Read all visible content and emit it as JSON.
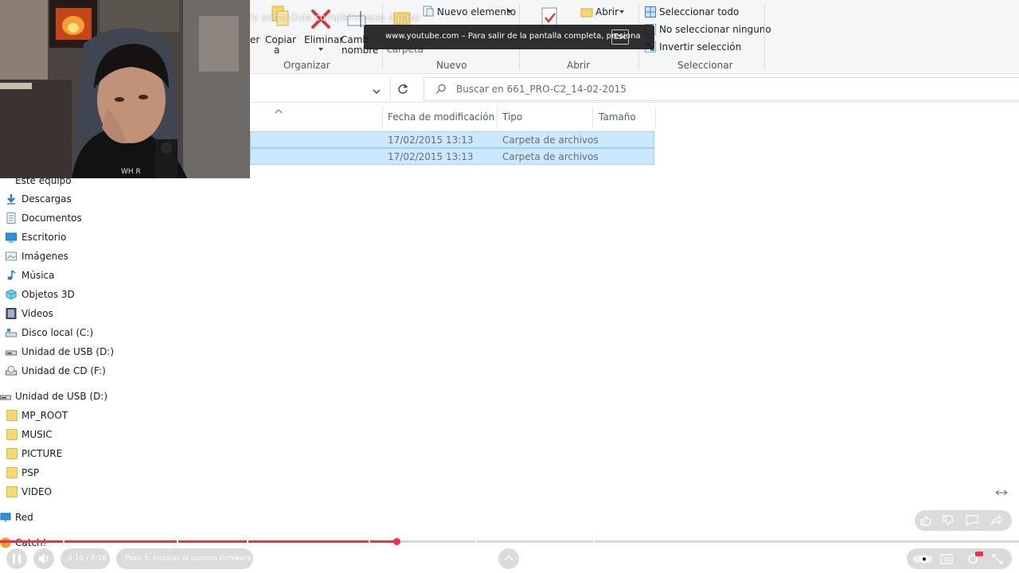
{
  "video_overlay": {
    "title_faint": "ly porta Guia completa paso a paso",
    "fullscreen_msg": "www.youtube.com – Para salir de la pantalla completa, presiona",
    "esc_key": "Esc"
  },
  "ribbon": {
    "organizar": {
      "label": "Organizar",
      "mover": "er",
      "copiar": "Copiar",
      "copiar_sub": "a",
      "eliminar": "Eliminar",
      "cambiar": "Camb",
      "cambiar_sub": "nombre"
    },
    "nuevo": {
      "label": "Nuevo",
      "nuevo_elemento": "Nuevo elemento",
      "carpeta": "carpeta"
    },
    "abrir": {
      "label": "Abrir",
      "abrir_btn": "Abrir"
    },
    "seleccionar": {
      "label": "Seleccionar",
      "todo": "Seleccionar todo",
      "ninguno": "No seleccionar ninguno",
      "invertir": "Invertir selección"
    }
  },
  "address": {
    "search_placeholder": "Buscar en 661_PRO-C2_14-02-2015"
  },
  "columns": {
    "fecha": "Fecha de modificación",
    "tipo": "Tipo",
    "tamano": "Tamaño"
  },
  "rows": [
    {
      "fecha": "17/02/2015 13:13",
      "tipo": "Carpeta de archivos"
    },
    {
      "fecha": "17/02/2015 13:13",
      "tipo": "Carpeta de archivos"
    }
  ],
  "nav": {
    "este_equipo": "Este equipo",
    "items": [
      "Descargas",
      "Documentos",
      "Escritorio",
      "Imágenes",
      "Música",
      "Objetos 3D",
      "Videos",
      "Disco local (C:)",
      "Unidad de USB (D:)",
      "Unidad de CD (F:)"
    ],
    "usb": "Unidad de USB (D:)",
    "usb_items": [
      "MP_ROOT",
      "MUSIC",
      "PICTURE",
      "PSP",
      "VIDEO"
    ],
    "red": "Red",
    "catch": "Catch!"
  },
  "player": {
    "time": "3:10 / 8:16",
    "chapter": "Paso 3: Instalar el custom firmware",
    "progress": 0.389,
    "accent": "#e8334a"
  }
}
